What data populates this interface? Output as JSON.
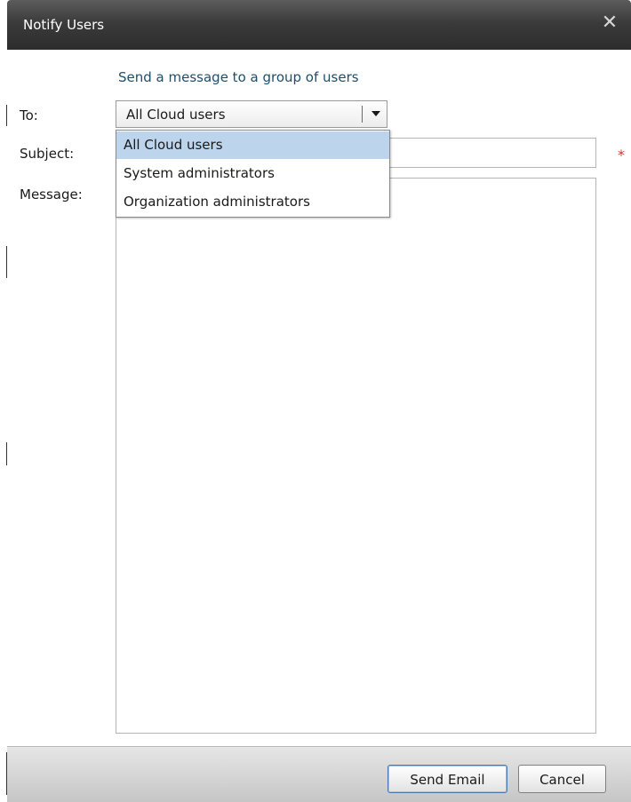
{
  "dialog": {
    "title": "Notify Users",
    "close_symbol": "✕",
    "header_message": "Send a message to a group of users"
  },
  "form": {
    "to_label": "To:",
    "subject_label": "Subject:",
    "message_label": "Message:",
    "to_selected": "All Cloud users",
    "subject_value": "",
    "message_value": "",
    "required_marker": "*"
  },
  "dropdown": {
    "options": [
      {
        "label": "All Cloud users",
        "selected": true
      },
      {
        "label": "System administrators",
        "selected": false
      },
      {
        "label": "Organization administrators",
        "selected": false
      }
    ]
  },
  "buttons": {
    "send": "Send Email",
    "cancel": "Cancel"
  },
  "icons": {
    "close": "close-icon",
    "dropdown": "chevron-down-icon",
    "required": "required-icon"
  },
  "colors": {
    "titlebar": "#3b3b3b",
    "header_text": "#1d4f6b",
    "selected_option": "#bcd4ec",
    "required": "#d9302c"
  }
}
